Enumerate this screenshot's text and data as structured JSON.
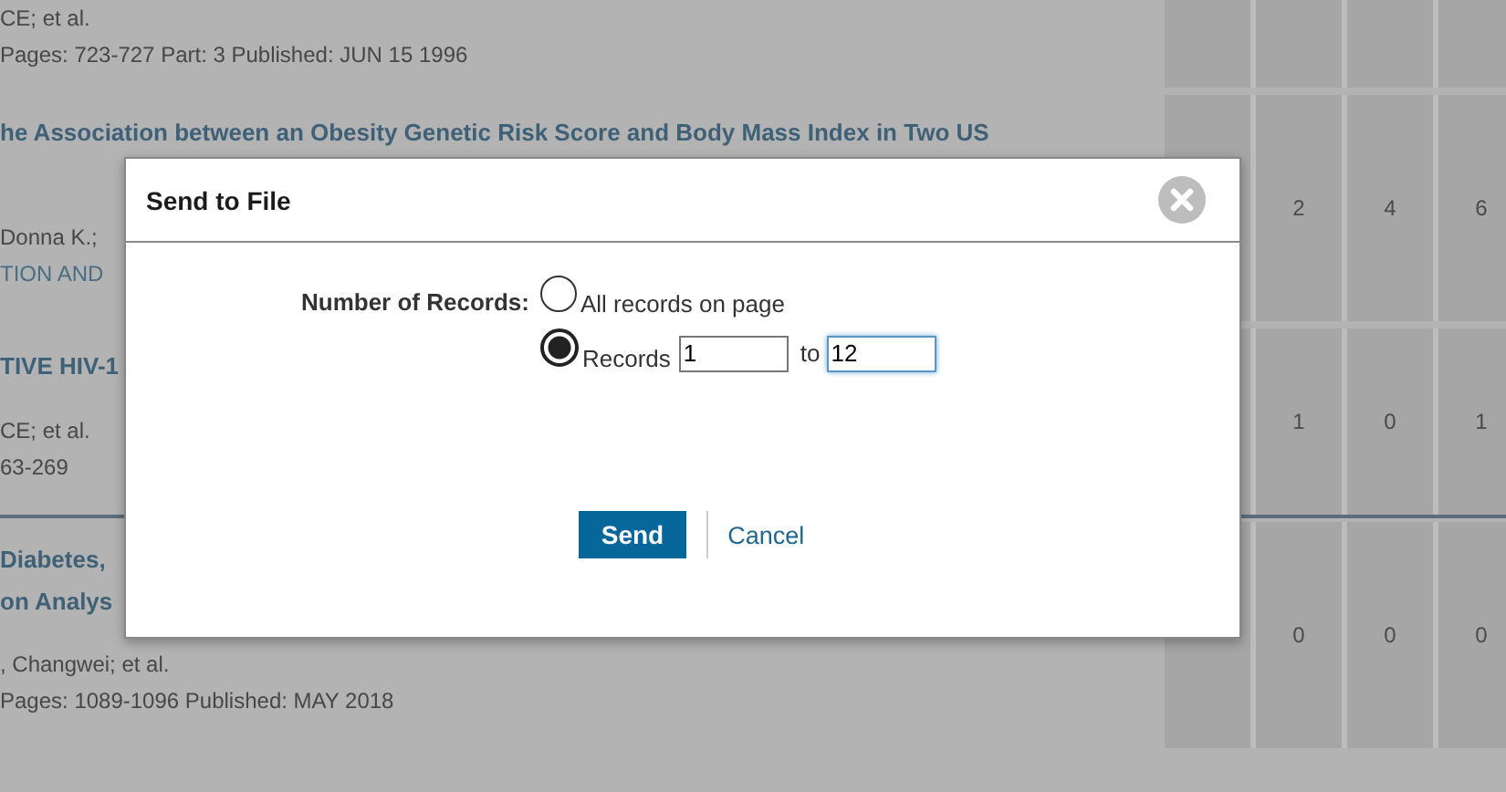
{
  "records": [
    {
      "authors": "CE; et al.",
      "source": "Pages: 723-727   Part: 3   Published: JUN 15 1996",
      "source_link": false
    },
    {
      "title_lines": [
        "he Association between an Obesity Genetic Risk Score and Body Mass Index in Two US"
      ],
      "authors": "Donna K.;",
      "source": "TION AND",
      "source_link": true,
      "counts": [
        "2",
        "4",
        "6"
      ]
    },
    {
      "title_lines": [
        "TIVE HIV-1"
      ],
      "authors": "CE; et al.",
      "source": "63-269",
      "source_link": false,
      "counts": [
        "1",
        "0",
        "1"
      ]
    },
    {
      "title_lines": [
        "Diabetes,",
        "on Analys"
      ],
      "authors": ", Changwei; et al.",
      "source": "Pages: 1089-1096   Published: MAY 2018",
      "source_link": false,
      "counts": [
        "0",
        "0",
        "0"
      ]
    }
  ],
  "dialog": {
    "title": "Send to File",
    "field_label": "Number of Records:",
    "options": [
      {
        "kind": "all",
        "label": "All records on page",
        "selected": false
      },
      {
        "kind": "range",
        "label": "Records",
        "selected": true,
        "from": "1",
        "to_label": "to",
        "to": "12"
      }
    ],
    "send": "Send",
    "cancel": "Cancel"
  }
}
